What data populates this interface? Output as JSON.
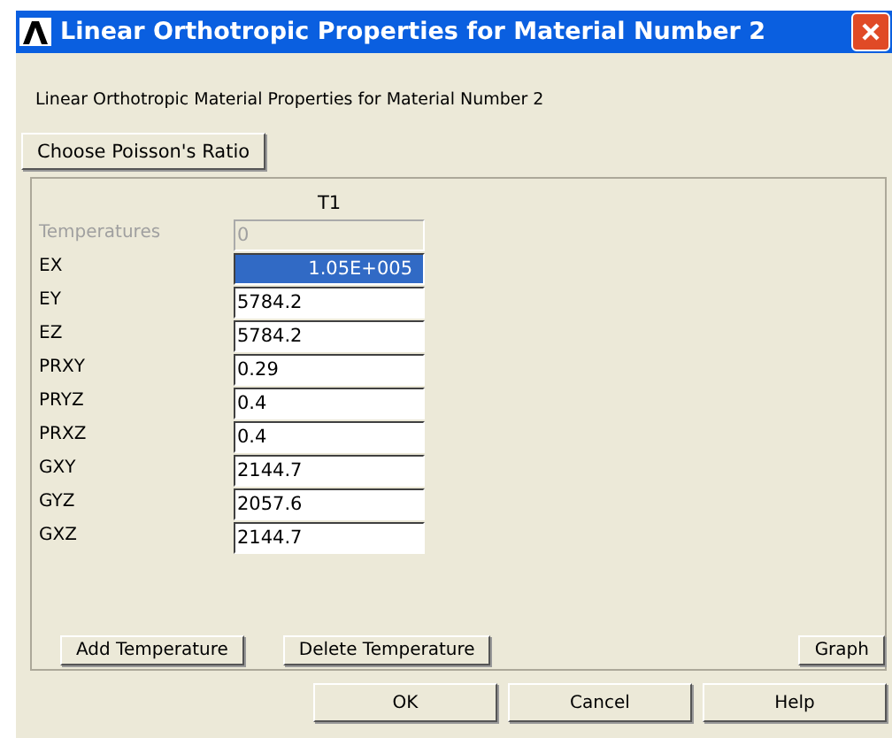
{
  "window": {
    "title": "Linear Orthotropic Properties for Material Number 2"
  },
  "heading": "Linear Orthotropic Material Properties for Material Number 2",
  "poisson_button": "Choose Poisson's Ratio",
  "table": {
    "column": "T1",
    "rows": [
      {
        "label": "Temperatures",
        "value": "0",
        "disabled": true,
        "selected": false
      },
      {
        "label": "EX",
        "value": "1.05E+005",
        "disabled": false,
        "selected": true
      },
      {
        "label": "EY",
        "value": "5784.2",
        "disabled": false,
        "selected": false
      },
      {
        "label": "EZ",
        "value": "5784.2",
        "disabled": false,
        "selected": false
      },
      {
        "label": "PRXY",
        "value": "0.29",
        "disabled": false,
        "selected": false
      },
      {
        "label": "PRYZ",
        "value": "0.4",
        "disabled": false,
        "selected": false
      },
      {
        "label": "PRXZ",
        "value": "0.4",
        "disabled": false,
        "selected": false
      },
      {
        "label": "GXY",
        "value": "2144.7",
        "disabled": false,
        "selected": false
      },
      {
        "label": "GYZ",
        "value": "2057.6",
        "disabled": false,
        "selected": false
      },
      {
        "label": "GXZ",
        "value": "2144.7",
        "disabled": false,
        "selected": false
      }
    ]
  },
  "panel_buttons": [
    "Add Temperature",
    "Delete Temperature",
    "Graph"
  ],
  "buttons": [
    "OK",
    "Cancel",
    "Help"
  ]
}
